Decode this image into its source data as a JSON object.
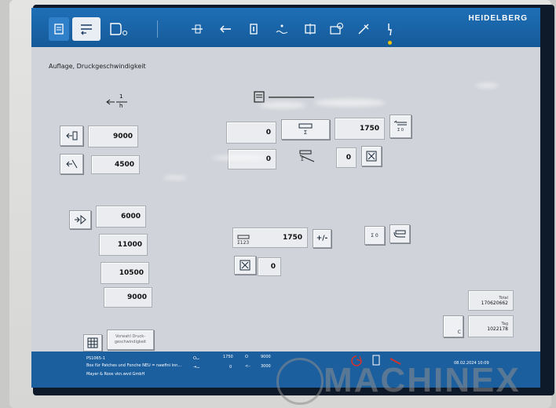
{
  "brand": "HEIDELBERG",
  "page_title": "Auflage, Druckgeschwindigkeit",
  "toolbar_icons": [
    "production-data-icon",
    "settings-icon",
    "printing-unit-icon",
    "register-icon",
    "arrow-left-icon",
    "feeder-icon",
    "ink-icon",
    "plate-icon",
    "camera-icon",
    "tools-icon",
    "power-icon"
  ],
  "speed_section": {
    "speed_label_num": "1",
    "speed_label_den": "h",
    "current_speed": "9000",
    "reduced_speed": "4500"
  },
  "counter_section": {
    "field_left": "0",
    "field_right": "1750",
    "field_left2": "0",
    "field_mid": "0",
    "counter_sigma": "Σ",
    "counter_sigma_sub": "Σ  0"
  },
  "presets": {
    "p1": "6000",
    "p2": "11000",
    "p3": "10500",
    "p4": "9000"
  },
  "total_counter": {
    "value": "1750",
    "sub": "Σ123",
    "plus_minus": "+/-",
    "waste_value": "0"
  },
  "totals": {
    "total_label": "Total",
    "total_value": "170620662",
    "day_label": "Tag",
    "day_value": "1022178",
    "c_button": "C"
  },
  "bottom": {
    "preset_button": "Vorwahl Druck-\ngeschwindigkeit"
  },
  "status": {
    "job_id": "PS1065-1",
    "job_desc": "Box für Patches und Fonche NEU = nawfini inn...",
    "customer": "Mayer & Roos vkn.wvd GmbH",
    "count_a": "1750",
    "count_b": "0",
    "speed_a": "9000",
    "speed_b": "3000",
    "datetime": "08.02.2024  10:09"
  },
  "watermark": "MACHINEX",
  "colors": {
    "toolbar": "#1f6fb8",
    "screen_bg": "#d0d3d9",
    "status_bg": "#1c5f9f",
    "accent_yellow": "#f2c200",
    "alert_red": "#d8302a"
  }
}
